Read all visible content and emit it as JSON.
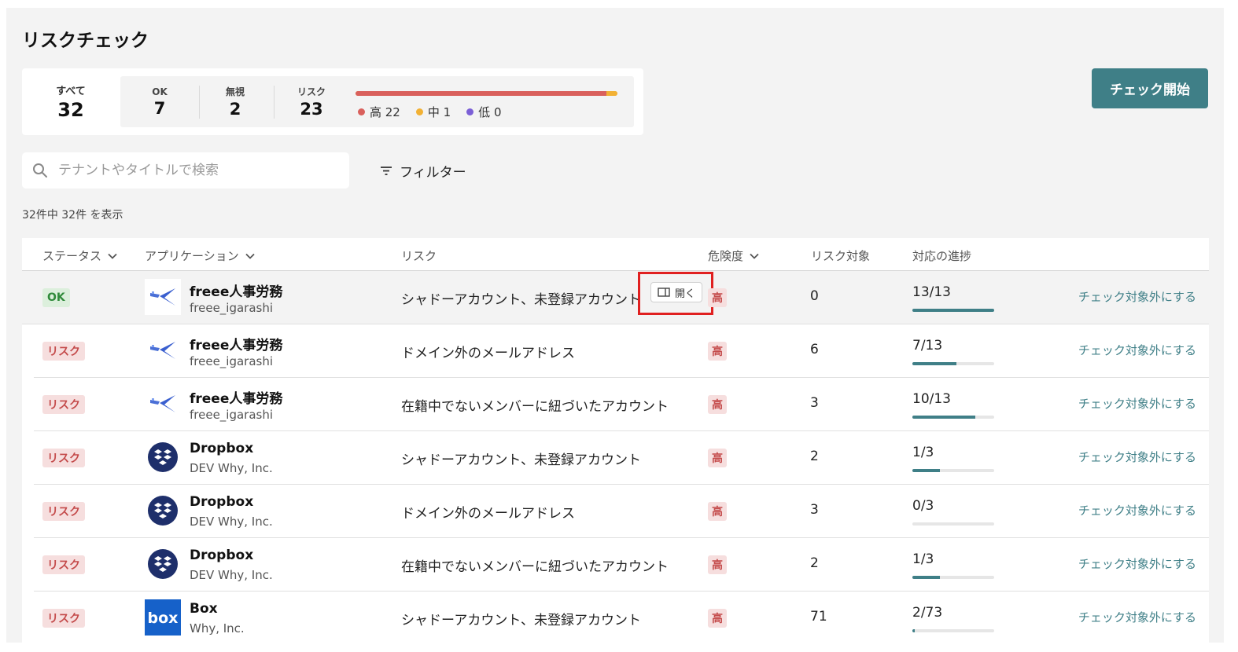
{
  "page": {
    "title": "リスクチェック"
  },
  "summary": {
    "all_label": "すべて",
    "all_count": "32",
    "ok_label": "OK",
    "ok_count": "7",
    "ignored_label": "無視",
    "ignored_count": "2",
    "risk_label": "リスク",
    "risk_count": "23",
    "legend": {
      "high": "高 22",
      "mid": "中 1",
      "low": "低 0"
    },
    "bar": {
      "high": 22,
      "mid": 1,
      "low": 0
    },
    "colors": {
      "high": "#d9605c",
      "mid": "#f2b134",
      "low": "#7b5fd6"
    }
  },
  "actions": {
    "start_check": "チェック開始",
    "filter": "フィルター"
  },
  "search": {
    "placeholder": "テナントやタイトルで検索"
  },
  "result_count": "32件中 32件 を表示",
  "table": {
    "headers": {
      "status": "ステータス",
      "application": "アプリケーション",
      "risk": "リスク",
      "severity": "危険度",
      "targets": "リスク対象",
      "progress": "対応の進捗"
    },
    "open_label": "開く",
    "rows": [
      {
        "status": "OK",
        "status_type": "ok",
        "app": "freee人事労務",
        "tenant": "freee_igarashi",
        "logo": "freee-logo-icon",
        "risk": "シャドーアカウント、未登録アカウント",
        "severity": "高",
        "targets": "0",
        "progress": "13/13",
        "progress_ratio": 1.0,
        "exclude": "チェック対象外にする"
      },
      {
        "status": "リスク",
        "status_type": "risk",
        "app": "freee人事労務",
        "tenant": "freee_igarashi",
        "logo": "freee-logo-icon",
        "risk": "ドメイン外のメールアドレス",
        "severity": "高",
        "targets": "6",
        "progress": "7/13",
        "progress_ratio": 0.538,
        "exclude": "チェック対象外にする"
      },
      {
        "status": "リスク",
        "status_type": "risk",
        "app": "freee人事労務",
        "tenant": "freee_igarashi",
        "logo": "freee-logo-icon",
        "risk": "在籍中でないメンバーに紐づいたアカウント",
        "severity": "高",
        "targets": "3",
        "progress": "10/13",
        "progress_ratio": 0.769,
        "exclude": "チェック対象外にする"
      },
      {
        "status": "リスク",
        "status_type": "risk",
        "app": "Dropbox",
        "tenant": "DEV Why, Inc.",
        "logo": "dropbox-logo-icon",
        "risk": "シャドーアカウント、未登録アカウント",
        "severity": "高",
        "targets": "2",
        "progress": "1/3",
        "progress_ratio": 0.333,
        "exclude": "チェック対象外にする"
      },
      {
        "status": "リスク",
        "status_type": "risk",
        "app": "Dropbox",
        "tenant": "DEV Why, Inc.",
        "logo": "dropbox-logo-icon",
        "risk": "ドメイン外のメールアドレス",
        "severity": "高",
        "targets": "3",
        "progress": "0/3",
        "progress_ratio": 0.0,
        "exclude": "チェック対象外にする"
      },
      {
        "status": "リスク",
        "status_type": "risk",
        "app": "Dropbox",
        "tenant": "DEV Why, Inc.",
        "logo": "dropbox-logo-icon",
        "risk": "在籍中でないメンバーに紐づいたアカウント",
        "severity": "高",
        "targets": "2",
        "progress": "1/3",
        "progress_ratio": 0.333,
        "exclude": "チェック対象外にする"
      },
      {
        "status": "リスク",
        "status_type": "risk",
        "app": "Box",
        "tenant": "Why, Inc.",
        "logo": "box-logo-icon",
        "risk": "シャドーアカウント、未登録アカウント",
        "severity": "高",
        "targets": "71",
        "progress": "2/73",
        "progress_ratio": 0.027,
        "exclude": "チェック対象外にする"
      }
    ]
  }
}
